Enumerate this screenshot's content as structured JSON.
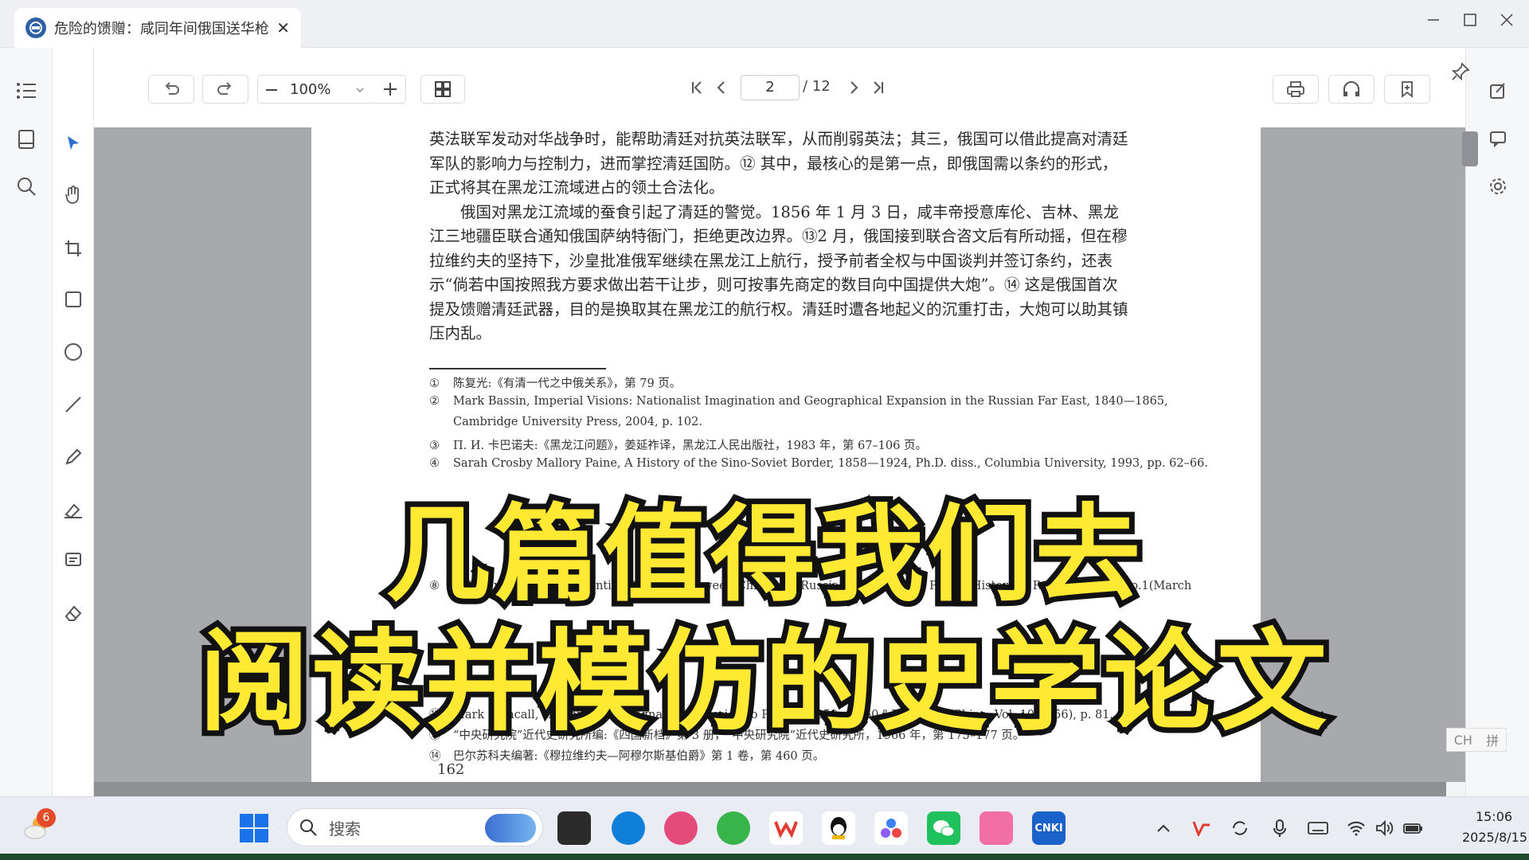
{
  "window": {
    "tab_title": "危险的馈赠：咸同年间俄国送华枪",
    "tab_close": "✕"
  },
  "toolbar": {
    "zoom": "100%",
    "current_page": "2",
    "total_pages": "/ 12"
  },
  "document": {
    "paragraphs": [
      "英法联军发动对华战争时，能帮助清廷对抗英法联军，从而削弱英法；其三，俄国可以借此提高对清廷军队的影响力与控制力，进而掌控清廷国防。⑫ 其中，最核心的是第一点，即俄国需以条约的形式，正式将其在黑龙江流域进占的领土合法化。",
      "　　俄国对黑龙江流域的蚕食引起了清廷的警觉。1856 年 1 月 3 日，咸丰帝授意库伦、吉林、黑龙江三地疆臣联合通知俄国萨纳特衙门，拒绝更改边界。⑬2 月，俄国接到联合咨文后有所动摇，但在穆拉维约夫的坚持下，沙皇批准俄军继续在黑龙江上航行，授予前者全权与中国谈判并签订条约，还表示“倘若中国按照我方要求做出若干让步，则可按事先商定的数目向中国提供大炮”。⑭ 这是俄国首次提及馈赠清廷武器，目的是换取其在黑龙江的航行权。清廷时遭各地起义的沉重打击，大炮可以助其镇压内乱。"
    ],
    "footnotes": [
      {
        "num": "①",
        "text": "陈复光:《有清一代之中俄关系》，第 79 页。"
      },
      {
        "num": "②",
        "text": "Mark Bassin, Imperial Visions: Nationalist Imagination and Geographical Expansion in the Russian Far East, 1840—1865,"
      },
      {
        "num": "",
        "text": "Cambridge University Press, 2004, p. 102."
      },
      {
        "num": "③",
        "text": "П. И. 卡巴诺夫:《黑龙江问题》，姜延祚译，黑龙江人民出版社，1983 年，第 67–106 页。"
      },
      {
        "num": "④",
        "text": "Sarah Crosby Mallory Paine, A History of the Sino-Soviet Border, 1858—1924, Ph.D. diss., Columbia University, 1993, pp. 62–66."
      },
      {
        "num": "⑧",
        "text": "T. C. Lin, \"The Amur Frontier Question between China and Russia, 1850—1860,\" Pacific Historical Review, Vol. 3, No.1(March"
      },
      {
        "num": "⑫",
        "text": "Mark Mancall, \"Major-General Ignatiev's Mission to Peking, 1859—1860,\" Papers on China, Vol. 10(1956), p. 81."
      },
      {
        "num": "⑬",
        "text": "“中央研究院”近代史研究所编:《四国新档》第 3 册，“中央研究院”近代史研究所，1966 年，第 175–177 页。"
      },
      {
        "num": "⑭",
        "text": "巴尔苏科夫编著:《穆拉维约夫—阿穆尔斯基伯爵》第 1 卷，第 460 页。"
      }
    ],
    "page_number": "162"
  },
  "overlay": {
    "line1": "几篇值得我们去",
    "line2": "阅读并模仿的史学论文"
  },
  "ime": {
    "lang": "CH",
    "mode": "拼"
  },
  "taskbar": {
    "search_placeholder": "搜索",
    "notification_count": "6",
    "time": "15:06",
    "date": "2025/8/15"
  },
  "colors": {
    "caption_fill": "#ffe933",
    "caption_stroke": "#111111",
    "doc_background": "#a7a9ad"
  }
}
